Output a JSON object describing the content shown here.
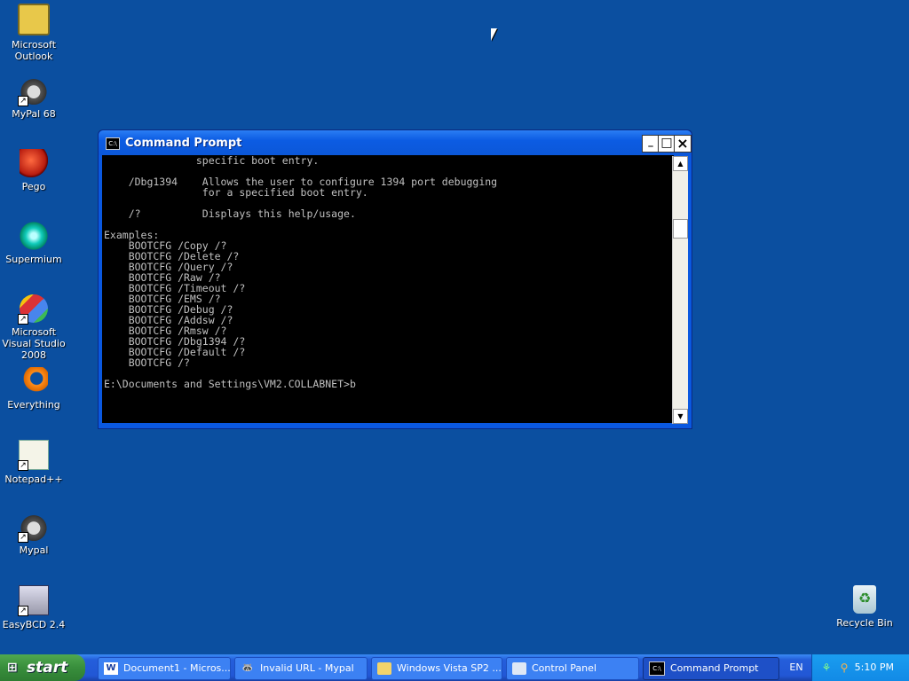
{
  "desktop": {
    "icons": [
      {
        "label": "Microsoft Outlook",
        "icon": "outlook-icon"
      },
      {
        "label": "MyPal 68",
        "icon": "raccoon-icon"
      },
      {
        "label": "Pego",
        "icon": "pego-icon"
      },
      {
        "label": "Supermium",
        "icon": "supermium-icon"
      },
      {
        "label": "Microsoft Visual Studio 2008",
        "icon": "visual-studio-icon"
      },
      {
        "label": "Everything",
        "icon": "everything-icon"
      },
      {
        "label": "Notepad++",
        "icon": "notepadpp-icon"
      },
      {
        "label": "Mypal",
        "icon": "raccoon-icon"
      },
      {
        "label": "EasyBCD 2.4",
        "icon": "easybcd-icon"
      },
      {
        "label": "Recycle Bin",
        "icon": "recycle-bin-icon"
      }
    ]
  },
  "window": {
    "title": "Command Prompt",
    "minimize": "_",
    "maximize": "□",
    "close": "×",
    "console_text": "               specific boot entry.\n\n    /Dbg1394    Allows the user to configure 1394 port debugging\n                for a specified boot entry.\n\n    /?          Displays this help/usage.\n\nExamples:\n    BOOTCFG /Copy /?\n    BOOTCFG /Delete /?\n    BOOTCFG /Query /?\n    BOOTCFG /Raw /?\n    BOOTCFG /Timeout /?\n    BOOTCFG /EMS /?\n    BOOTCFG /Debug /?\n    BOOTCFG /Addsw /?\n    BOOTCFG /Rmsw /?\n    BOOTCFG /Dbg1394 /?\n    BOOTCFG /Default /?\n    BOOTCFG /?\n\nE:\\Documents and Settings\\VM2.COLLABNET>b"
  },
  "taskbar": {
    "start_label": "start",
    "tasks": [
      {
        "label": "Document1 - Micros...",
        "icon": "word-icon"
      },
      {
        "label": "Invalid URL - Mypal",
        "icon": "raccoon-icon"
      },
      {
        "label": "Windows Vista SP2 ...",
        "icon": "folder-icon"
      },
      {
        "label": "Control Panel",
        "icon": "control-panel-icon"
      },
      {
        "label": "Command Prompt",
        "icon": "cmd-icon"
      }
    ],
    "language": "EN",
    "clock": "5:10 PM"
  },
  "colors": {
    "desktop": "#0b4fa0",
    "console_bg": "#000000",
    "console_fg": "#c0c0c0",
    "titlebar": "#0c5ce3"
  }
}
